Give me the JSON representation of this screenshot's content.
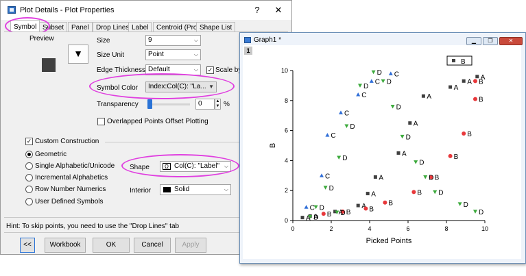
{
  "dialog": {
    "title": "Plot Details - Plot Properties",
    "help_glyph": "?",
    "close_glyph": "✕",
    "tabs": [
      "Symbol",
      "Subset",
      "Panel",
      "Drop Lines",
      "Label",
      "Centroid (Pro)",
      "Shape List"
    ],
    "selected_tab": "Symbol",
    "preview_label": "Preview",
    "size_label": "Size",
    "size_value": "9",
    "size_unit_label": "Size Unit",
    "size_unit_value": "Point",
    "edge_thickness_label": "Edge Thickness",
    "edge_thickness_value": "Default",
    "scale_by_size_label": "Scale by S",
    "symbol_color_label": "Symbol Color",
    "symbol_color_value": "Index:Col(C): \"La...",
    "transparency_label": "Transparency",
    "transparency_value": "0",
    "transparency_unit": "%",
    "overlapped_label": "Overlapped Points Offset Plotting",
    "custom_construction_label": "Custom Construction",
    "radios": [
      "Geometric",
      "Single Alphabetic/Unicode",
      "Incremental Alphabetics",
      "Row Number Numerics",
      "User Defined Symbols"
    ],
    "selected_radio": "Geometric",
    "shape_label": "Shape",
    "shape_value": "Col(C): \"Label\"",
    "interior_label": "Interior",
    "interior_value": "Solid",
    "hint": "Hint: To skip points, you need to use the \"Drop Lines\" tab",
    "buttons": {
      "collapse": "<<",
      "workbook": "Workbook",
      "ok": "OK",
      "cancel": "Cancel",
      "apply": "Apply"
    },
    "callout_color": "#e040e0"
  },
  "graph_window": {
    "title": "Graph1 *",
    "layer_badge": "1",
    "legend_label": "B",
    "close_glyph": "✕"
  },
  "chart_data": {
    "type": "scatter",
    "xlabel": "Picked Points",
    "ylabel": "B",
    "xlim": [
      0,
      10
    ],
    "ylim": [
      0,
      10
    ],
    "xticks": [
      "0",
      "2",
      "4",
      "6",
      "8",
      "10"
    ],
    "yticks": [
      "0",
      "2",
      "4",
      "6",
      "8",
      "10"
    ],
    "colors": {
      "A": "#404040",
      "B": "#e8383b",
      "C": "#2f6ed8",
      "D": "#3caa3c"
    },
    "symbols": {
      "A": "square",
      "B": "circle",
      "C": "triangle-up",
      "D": "triangle-down"
    },
    "points": [
      {
        "x": 0.5,
        "y": 0.2,
        "label": "A"
      },
      {
        "x": 0.9,
        "y": 0.3,
        "label": "A"
      },
      {
        "x": 2.2,
        "y": 0.6,
        "label": "A"
      },
      {
        "x": 3.4,
        "y": 1.0,
        "label": "A"
      },
      {
        "x": 3.9,
        "y": 1.8,
        "label": "A"
      },
      {
        "x": 4.3,
        "y": 2.9,
        "label": "A"
      },
      {
        "x": 5.5,
        "y": 4.5,
        "label": "A"
      },
      {
        "x": 6.1,
        "y": 6.5,
        "label": "A"
      },
      {
        "x": 6.8,
        "y": 8.3,
        "label": "A"
      },
      {
        "x": 8.2,
        "y": 8.9,
        "label": "A"
      },
      {
        "x": 8.9,
        "y": 9.3,
        "label": "A"
      },
      {
        "x": 9.6,
        "y": 9.6,
        "label": "A"
      },
      {
        "x": 1.6,
        "y": 0.45,
        "label": "B"
      },
      {
        "x": 2.6,
        "y": 0.6,
        "label": "B"
      },
      {
        "x": 3.8,
        "y": 0.8,
        "label": "B"
      },
      {
        "x": 4.8,
        "y": 1.2,
        "label": "B"
      },
      {
        "x": 6.3,
        "y": 1.9,
        "label": "B"
      },
      {
        "x": 7.2,
        "y": 2.9,
        "label": "B"
      },
      {
        "x": 8.2,
        "y": 4.3,
        "label": "B"
      },
      {
        "x": 8.9,
        "y": 5.8,
        "label": "B"
      },
      {
        "x": 9.5,
        "y": 8.1,
        "label": "B"
      },
      {
        "x": 9.5,
        "y": 9.3,
        "label": "B"
      },
      {
        "x": 0.7,
        "y": 0.9,
        "label": "C"
      },
      {
        "x": 1.5,
        "y": 3.0,
        "label": "C"
      },
      {
        "x": 1.8,
        "y": 5.7,
        "label": "C"
      },
      {
        "x": 2.5,
        "y": 7.2,
        "label": "C"
      },
      {
        "x": 3.4,
        "y": 8.4,
        "label": "C"
      },
      {
        "x": 4.1,
        "y": 9.3,
        "label": "C"
      },
      {
        "x": 5.1,
        "y": 9.8,
        "label": "C"
      },
      {
        "x": 1.2,
        "y": 0.9,
        "label": "D"
      },
      {
        "x": 1.7,
        "y": 2.2,
        "label": "D"
      },
      {
        "x": 2.4,
        "y": 4.2,
        "label": "D"
      },
      {
        "x": 2.8,
        "y": 6.3,
        "label": "D"
      },
      {
        "x": 3.5,
        "y": 9.0,
        "label": "D"
      },
      {
        "x": 4.2,
        "y": 9.9,
        "label": "D"
      },
      {
        "x": 4.7,
        "y": 9.3,
        "label": "D"
      },
      {
        "x": 5.2,
        "y": 7.6,
        "label": "D"
      },
      {
        "x": 5.7,
        "y": 5.6,
        "label": "D"
      },
      {
        "x": 6.4,
        "y": 3.9,
        "label": "D"
      },
      {
        "x": 6.9,
        "y": 2.9,
        "label": "D"
      },
      {
        "x": 7.4,
        "y": 1.9,
        "label": "D"
      },
      {
        "x": 8.7,
        "y": 1.1,
        "label": "D"
      },
      {
        "x": 9.5,
        "y": 0.6,
        "label": "D"
      },
      {
        "x": 0.9,
        "y": 0.25,
        "label": "D"
      },
      {
        "x": 2.3,
        "y": 0.55,
        "label": "D"
      }
    ]
  }
}
